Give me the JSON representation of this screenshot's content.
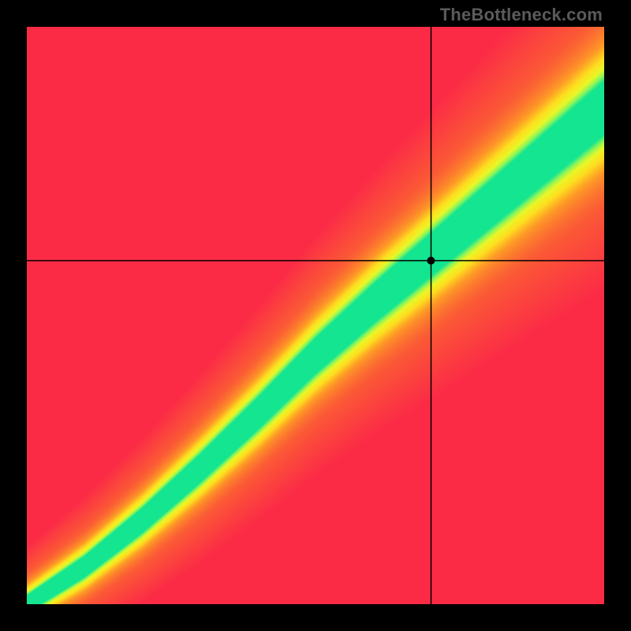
{
  "watermark": "TheBottleneck.com",
  "chart_data": {
    "type": "heatmap",
    "title": "",
    "xlabel": "",
    "ylabel": "",
    "xlim": [
      0,
      1
    ],
    "ylim": [
      0,
      1
    ],
    "crosshair": {
      "x": 0.7,
      "y": 0.595
    },
    "marker": {
      "x": 0.7,
      "y": 0.595,
      "radius": 5
    },
    "ridge_control_points": [
      {
        "x": 0.0,
        "y": 0.0
      },
      {
        "x": 0.1,
        "y": 0.065
      },
      {
        "x": 0.2,
        "y": 0.145
      },
      {
        "x": 0.3,
        "y": 0.235
      },
      {
        "x": 0.4,
        "y": 0.33
      },
      {
        "x": 0.5,
        "y": 0.43
      },
      {
        "x": 0.6,
        "y": 0.52
      },
      {
        "x": 0.7,
        "y": 0.605
      },
      {
        "x": 0.8,
        "y": 0.69
      },
      {
        "x": 0.9,
        "y": 0.775
      },
      {
        "x": 1.0,
        "y": 0.86
      }
    ],
    "color_stops": [
      {
        "t": 0.0,
        "color": "#fb2b46"
      },
      {
        "t": 0.3,
        "color": "#fb5a35"
      },
      {
        "t": 0.55,
        "color": "#fd9a26"
      },
      {
        "t": 0.72,
        "color": "#fede1f"
      },
      {
        "t": 0.85,
        "color": "#e7f727"
      },
      {
        "t": 0.93,
        "color": "#8cf55b"
      },
      {
        "t": 1.0,
        "color": "#13e591"
      }
    ],
    "band_half_width": 0.075,
    "width_scale_with_x": 0.9,
    "grid_on": false,
    "legend": null
  }
}
